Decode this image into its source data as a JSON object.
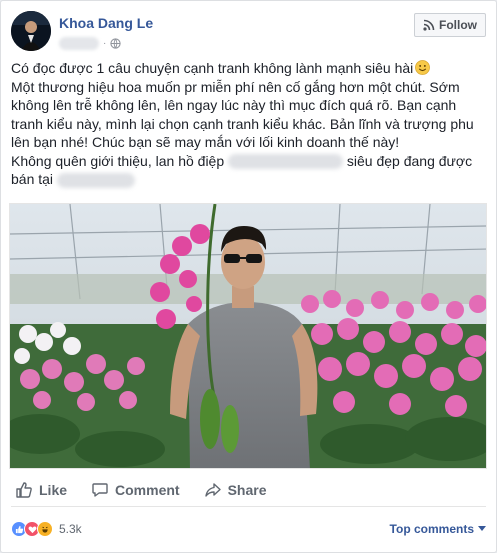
{
  "post": {
    "author": "Khoa Dang Le",
    "follow_label": "Follow",
    "text_lines": [
      "Có đọc được 1 câu chuyện cạnh tranh không lành mạnh siêu hài",
      "Một thương hiệu hoa muốn pr miễn phí nên cố gắng hơn một chút. Sớm không lên trễ không lên, lên ngay lúc này thì mục đích quá rõ. Bạn cạnh tranh kiểu này, mình lại chọn cạnh tranh kiểu khác. Bản lĩnh và trượng phu lên bạn nhé! Chúc bạn sẽ may mắn với lối kinh doanh thế này!",
      "Không quên giới thiệu, lan hồ điệp",
      "siêu đẹp đang được",
      "bán tại"
    ]
  },
  "actions": {
    "like": "Like",
    "comment": "Comment",
    "share": "Share"
  },
  "reactions": {
    "count": "5.3k",
    "sort_label": "Top comments"
  },
  "icons": [
    "globe-icon",
    "rss-icon",
    "smiley-icon",
    "like-icon",
    "comment-icon",
    "share-icon",
    "chevron-down-icon"
  ],
  "colors": {
    "link": "#365899",
    "like_blue": "#5890ff",
    "love_red": "#f25268",
    "haha_yellow": "#f7b125"
  }
}
